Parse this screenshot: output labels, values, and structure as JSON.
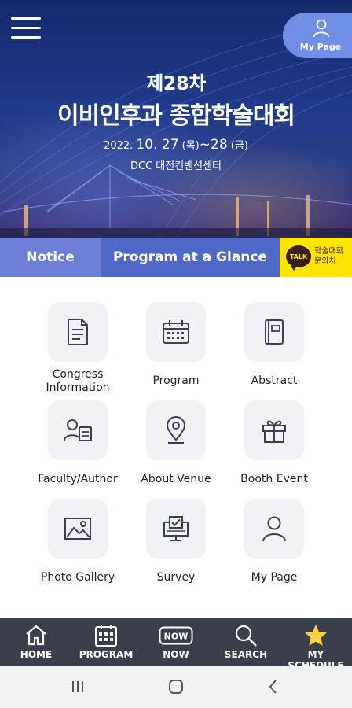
{
  "header": {
    "menu_icon": "hamburger-menu-icon",
    "mypage_label": "My Page",
    "title_line1": "제28차",
    "title_line2": "이비인후과 종합학술대회",
    "date_prefix": "2022. ",
    "date_start": "10. 27",
    "date_start_day": " (목)",
    "date_sep": "~",
    "date_end": "28",
    "date_end_day": " (금)",
    "venue": "DCC 대전컨벤션센터"
  },
  "tabs": {
    "notice": "Notice",
    "program": "Program at a Glance",
    "kakao_badge": "TALK",
    "kakao_line1": "학술대회",
    "kakao_line2": "문의처"
  },
  "grid": [
    {
      "label": "Congress Information",
      "icon": "document-icon"
    },
    {
      "label": "Program",
      "icon": "calendar-icon"
    },
    {
      "label": "Abstract",
      "icon": "book-icon"
    },
    {
      "label": "Faculty/Author",
      "icon": "person-card-icon"
    },
    {
      "label": "About Venue",
      "icon": "location-pin-icon"
    },
    {
      "label": "Booth Event",
      "icon": "gift-icon"
    },
    {
      "label": "Photo Gallery",
      "icon": "image-icon"
    },
    {
      "label": "Survey",
      "icon": "survey-monitor-icon"
    },
    {
      "label": "My Page",
      "icon": "person-icon"
    }
  ],
  "bottom_nav": [
    {
      "label": "HOME",
      "icon": "home-icon"
    },
    {
      "label": "PROGRAM",
      "icon": "calendar-grid-icon"
    },
    {
      "label": "NOW",
      "icon": "now-badge-icon",
      "badge": "NOW"
    },
    {
      "label": "SEARCH",
      "icon": "search-icon"
    },
    {
      "label": "MY SCHEDULE",
      "icon": "star-icon"
    }
  ],
  "colors": {
    "primary": "#4f69c9",
    "notice_tab": "#6b80d6",
    "kakao": "#fee500",
    "nav_bg": "#3b3f4c",
    "star": "#ffd43b"
  }
}
